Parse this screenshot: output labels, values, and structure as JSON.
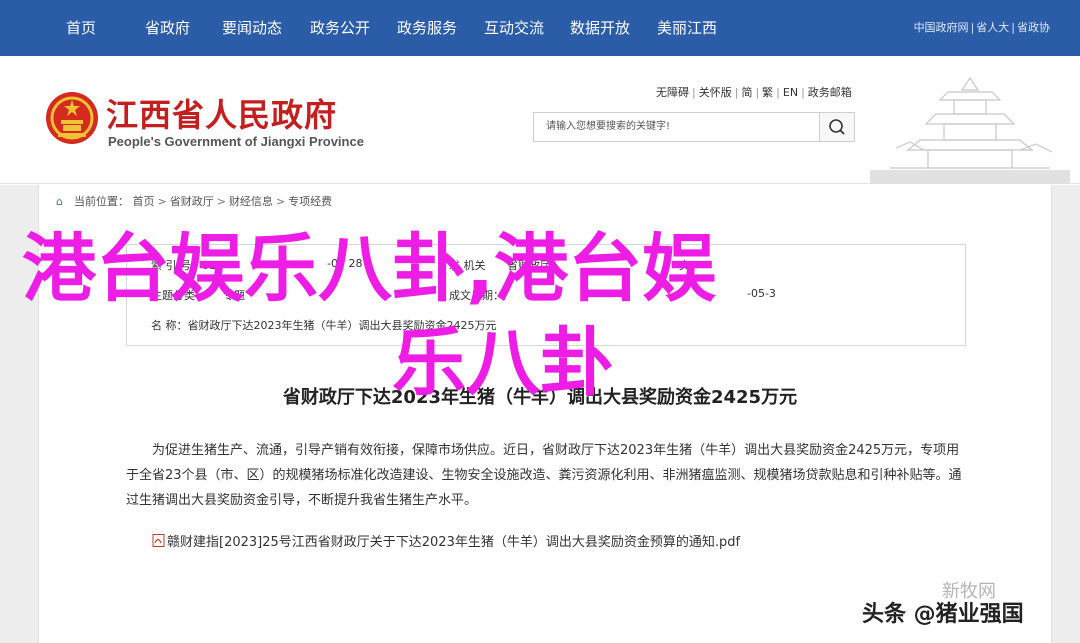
{
  "topnav": {
    "items": [
      "首页",
      "省政府",
      "要闻动态",
      "政务公开",
      "政务服务",
      "互动交流",
      "数据开放",
      "美丽江西"
    ],
    "right_links": [
      "中国政府网",
      "省人大",
      "省政协"
    ]
  },
  "header": {
    "title": "江西省人民政府",
    "subtitle": "People's Government of Jiangxi Province",
    "util_links": [
      "无障碍",
      "关怀版",
      "简",
      "繁",
      "EN",
      "政务邮箱"
    ],
    "search_placeholder": "请输入您想要搜索的关键字!"
  },
  "breadcrumb": {
    "label": "当前位置：",
    "items": [
      "首页",
      "省财政厅",
      "财经信息",
      "专项经费"
    ]
  },
  "meta": {
    "row1_a": "索 引 号：01",
    "row1_b": "-00 28",
    "row1_c": "发 机关",
    "row1_d": "省财政厅",
    "row1_e": "文",
    "row2_a": "主题分类：",
    "row2_b": "专题",
    "row2_c": "成文日期：",
    "row2_d": "-05-3",
    "row3": "名 称：省财政厅下达2023年生猪（牛羊）调出大县奖励资金2425万元"
  },
  "article": {
    "title": "省财政厅下达2023年生猪（牛羊）调出大县奖励资金2425万元",
    "paragraph": "为促进生猪生产、流通，引导产销有效衔接，保障市场供应。近日，省财政厅下达2023年生猪（牛羊）调出大县奖励资金2425万元，专项用于全省23个县（市、区）的规模猪场标准化改造建设、生物安全设施改造、粪污资源化利用、非洲猪瘟监测、规模猪场贷款贴息和引种补贴等。通过生猪调出大县奖励资金引导，不断提升我省生猪生产水平。",
    "attachment": "赣财建指[2023]25号江西省财政厅关于下达2023年生猪（牛羊）调出大县奖励资金预算的通知.pdf"
  },
  "overlay": {
    "line1": "港台娱乐八卦,港台娱",
    "line2": "乐八卦"
  },
  "watermark": {
    "source": "新牧网",
    "credit": "头条 @猪业强国"
  },
  "colors": {
    "nav_bg": "#2a5ca8",
    "title_red": "#c41f1f",
    "overlay_magenta": "#ee1de6"
  }
}
